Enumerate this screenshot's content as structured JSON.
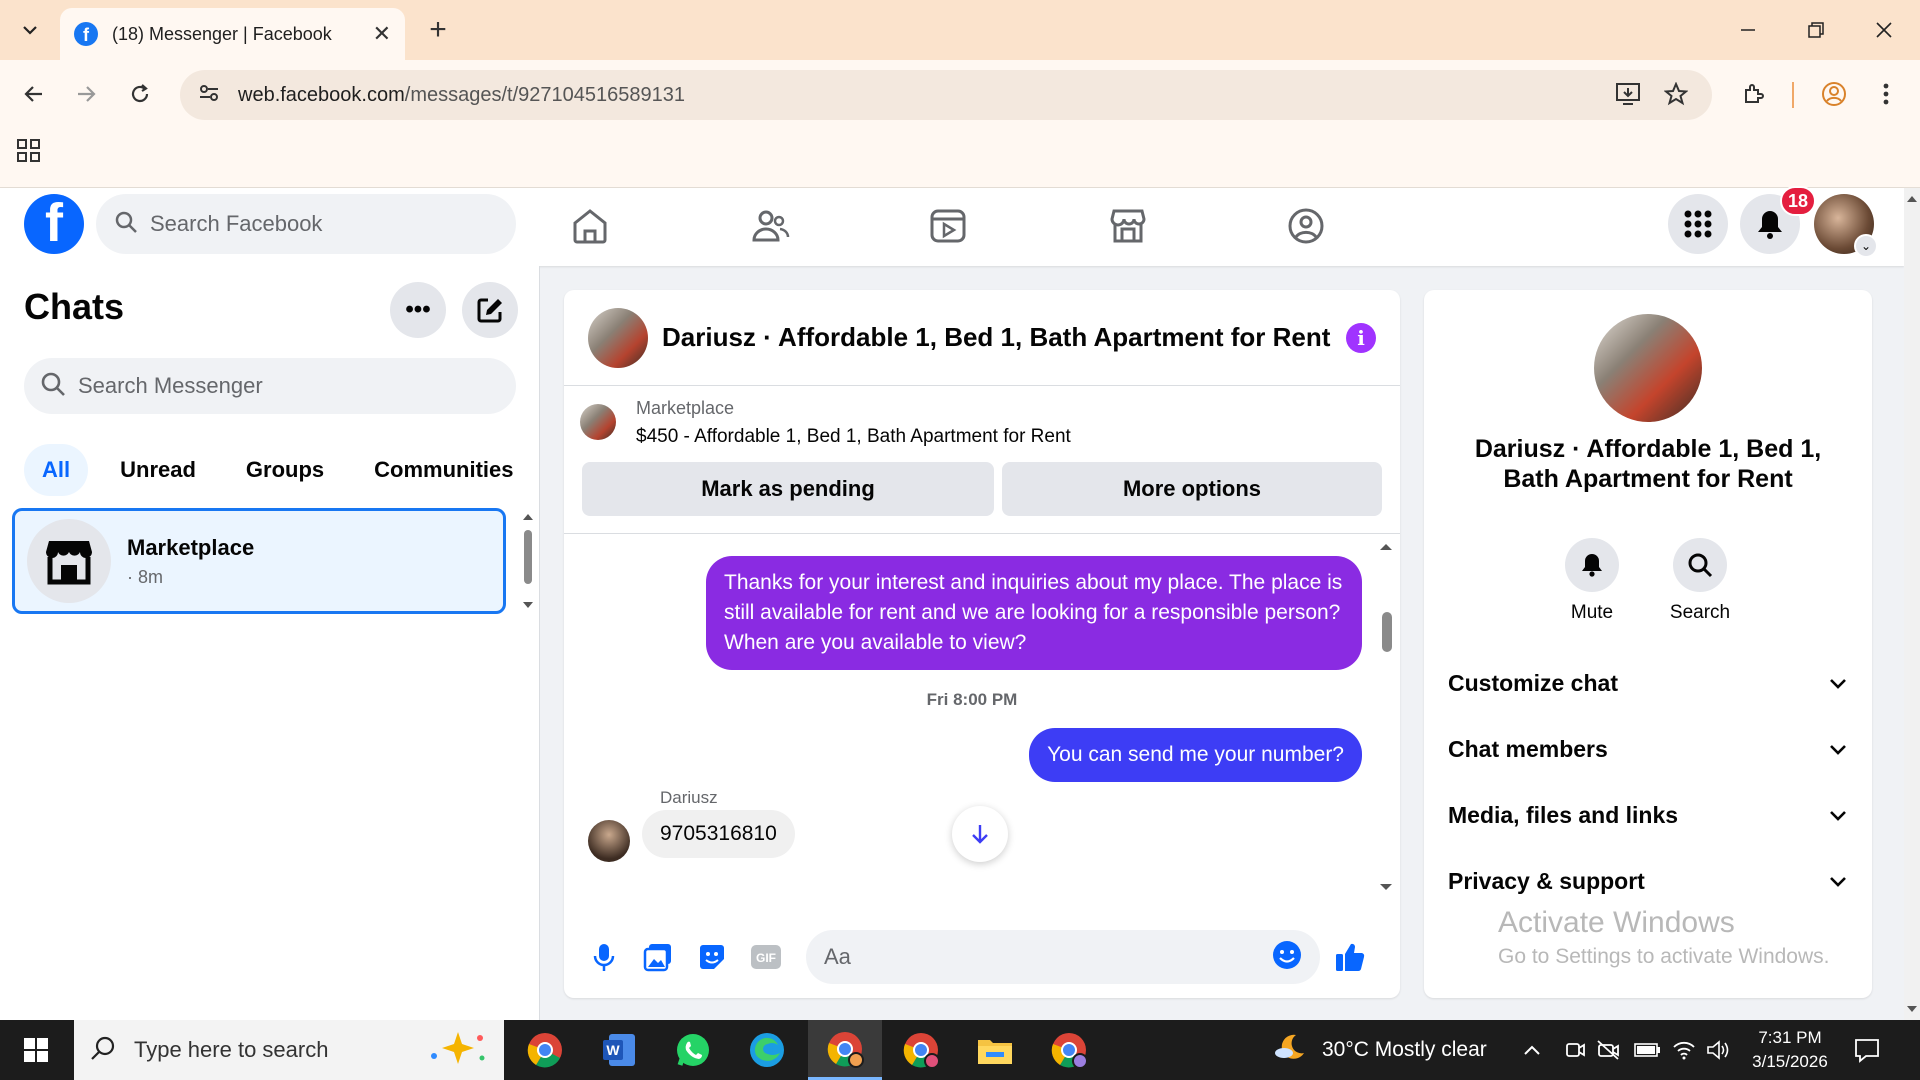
{
  "browser": {
    "tab_title": "(18) Messenger | Facebook",
    "url_host": "web.facebook.com",
    "url_path": "/messages/t/927104516589131"
  },
  "fb_header": {
    "search_placeholder": "Search Facebook",
    "notification_count": "18"
  },
  "chats": {
    "title": "Chats",
    "search_placeholder": "Search Messenger",
    "filters": [
      "All",
      "Unread",
      "Groups",
      "Communities"
    ],
    "active_filter": "All",
    "items": [
      {
        "name": "Marketplace",
        "time": "· 8m"
      }
    ]
  },
  "conversation": {
    "title": "Dariusz · Affordable 1, Bed 1, Bath Apartment for Rent",
    "listing": {
      "tag": "Marketplace",
      "title": "$450 - Affordable 1, Bed 1, Bath Apartment for Rent",
      "pending_label": "Mark as pending",
      "options_label": "More options"
    },
    "messages": [
      {
        "from": "me",
        "text": "Thanks for your interest and inquiries about my place. The place is still available for rent and we are looking for a responsible person? When are you available to view?",
        "color": "#8a2be2"
      },
      {
        "timestamp": "Fri 8:00 PM"
      },
      {
        "from": "me",
        "text": "You can send me your number?",
        "color": "#3d3df5"
      },
      {
        "from": "Dariusz",
        "sender_label": "Dariusz",
        "text": "9705316810"
      }
    ],
    "composer_placeholder": "Aa"
  },
  "details": {
    "name": "Dariusz · Affordable 1, Bed 1, Bath Apartment for Rent",
    "actions": [
      {
        "label": "Mute",
        "icon": "bell-icon"
      },
      {
        "label": "Search",
        "icon": "search-icon"
      }
    ],
    "sections": [
      "Customize chat",
      "Chat members",
      "Media, files and links",
      "Privacy & support"
    ]
  },
  "watermark": {
    "line1": "Activate Windows",
    "line2": "Go to Settings to activate Windows."
  },
  "taskbar": {
    "search_placeholder": "Type here to search",
    "weather": "30°C  Mostly clear",
    "time": "7:31 PM",
    "date": "3/15/2026"
  },
  "colors": {
    "accent": "#0866ff",
    "outgoing_purple": "#8a2be2",
    "outgoing_blue": "#3d3df5",
    "badge_red": "#e41e3f"
  }
}
